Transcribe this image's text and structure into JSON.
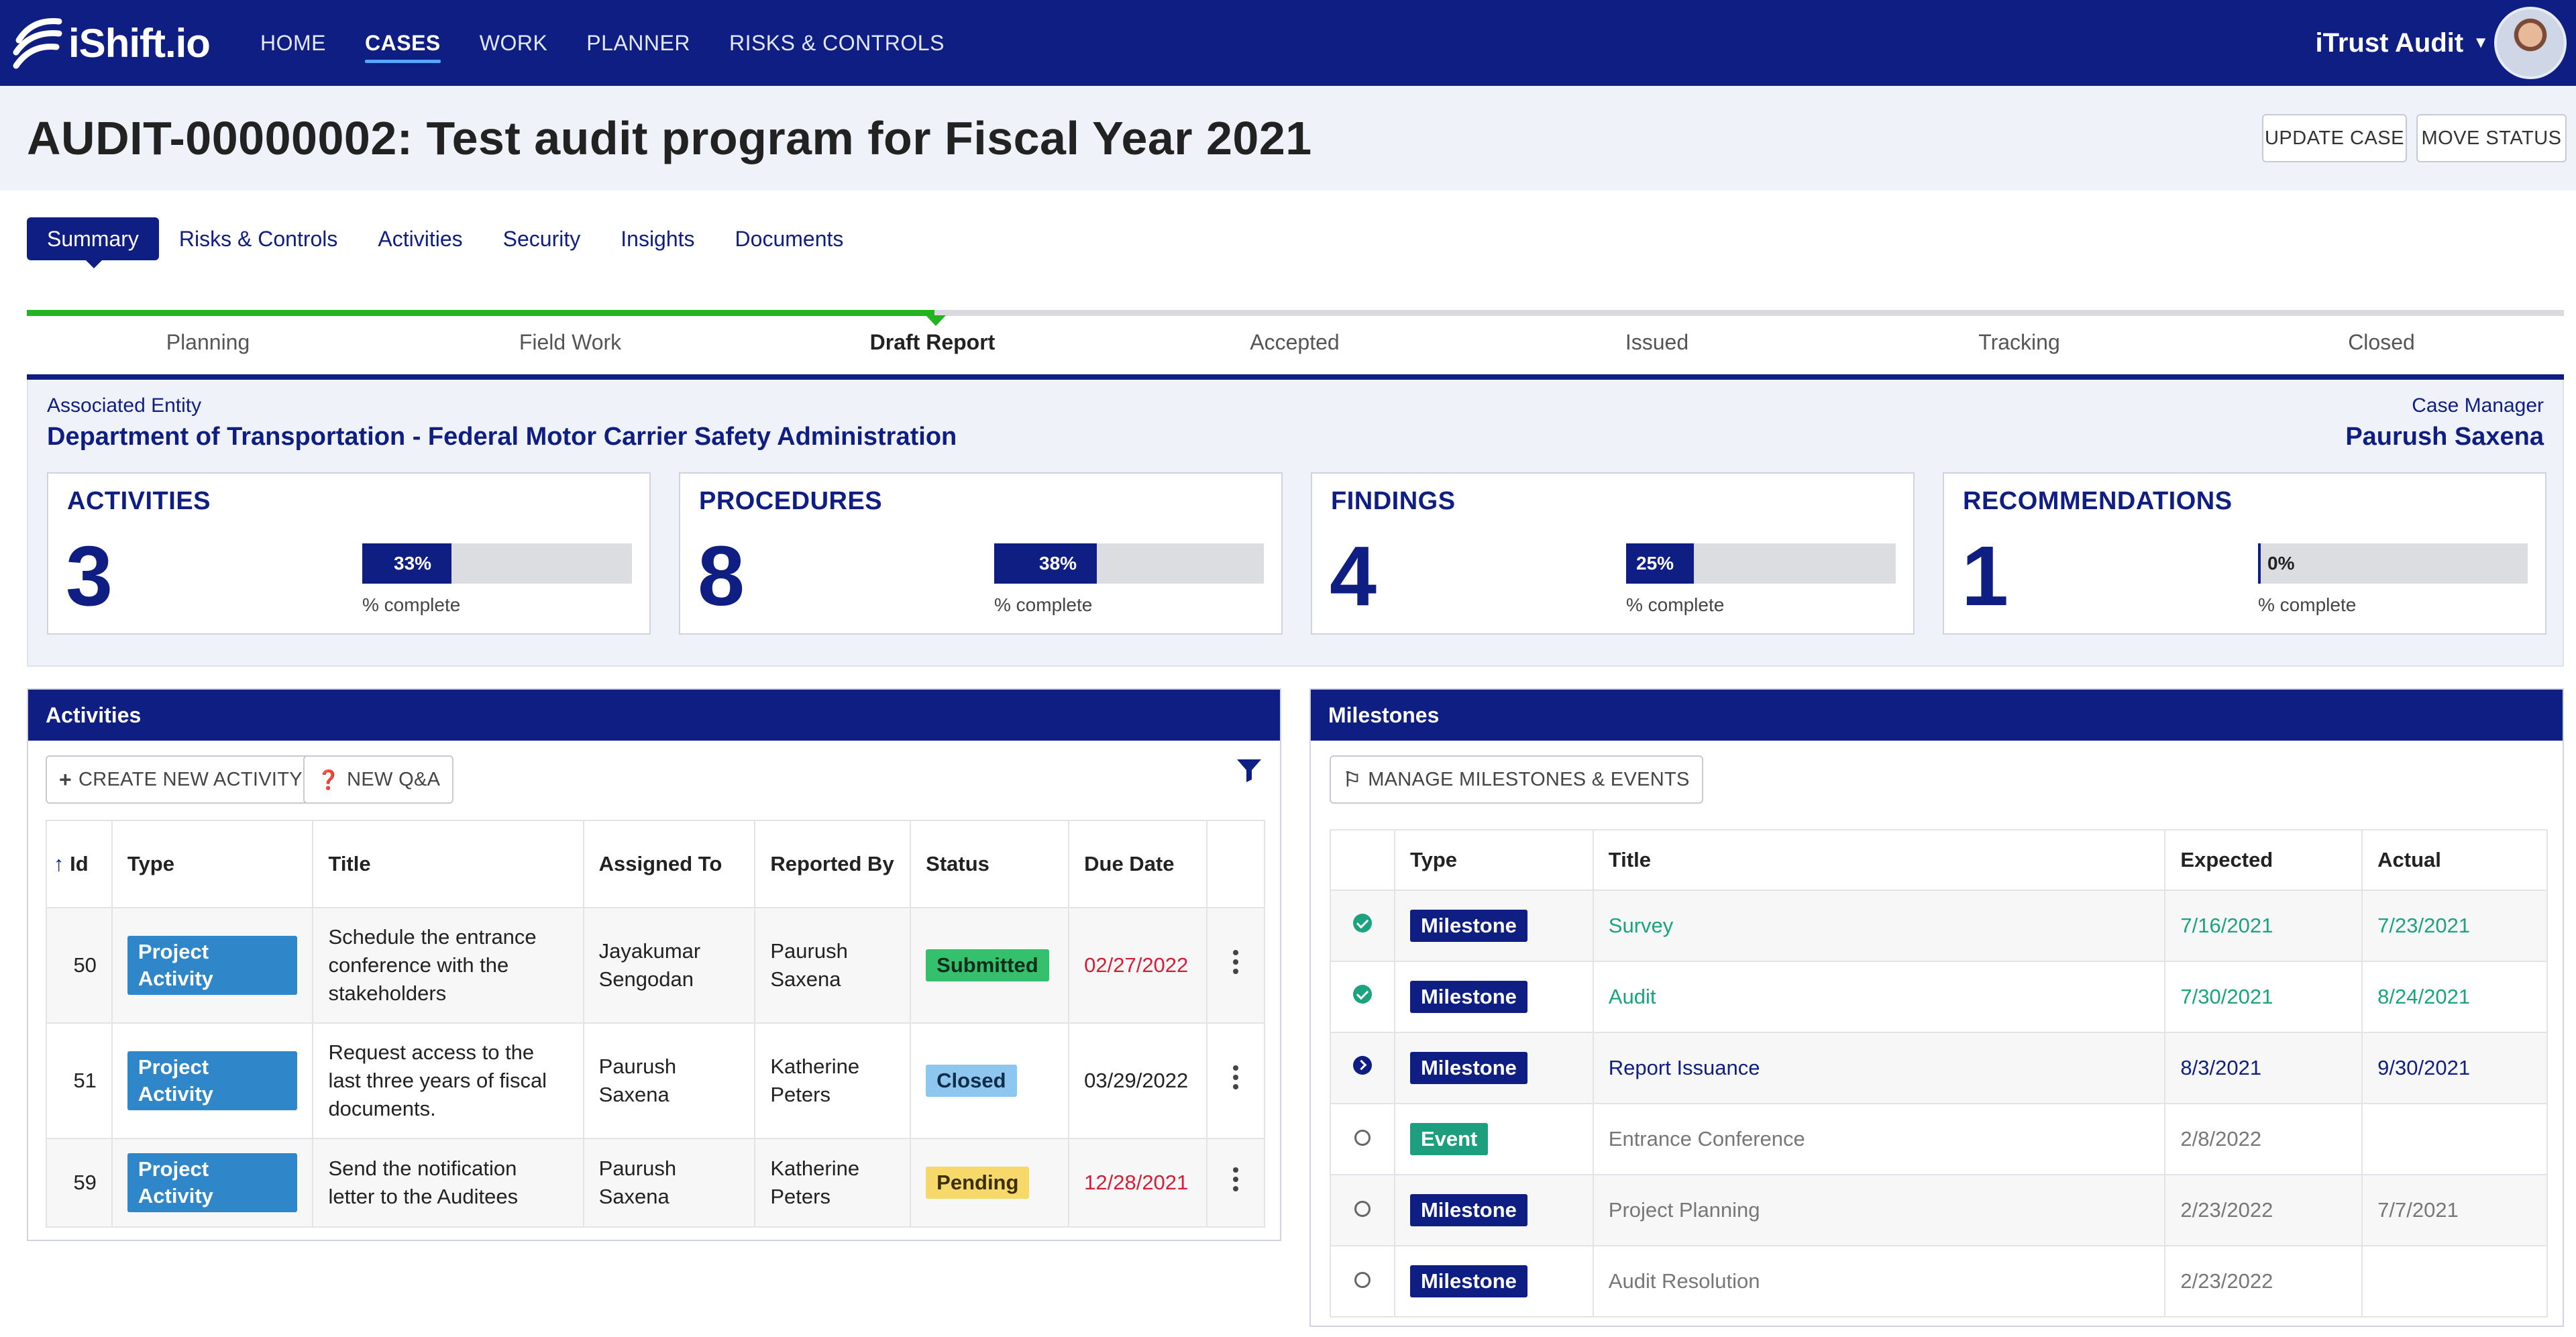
{
  "app": {
    "logo_text": "iShift.io",
    "nav": [
      "HOME",
      "CASES",
      "WORK",
      "PLANNER",
      "RISKS & CONTROLS"
    ],
    "active_nav": "CASES",
    "org_name": "iTrust Audit",
    "avatar": "user-avatar"
  },
  "case": {
    "title": "AUDIT-00000002: Test audit program for Fiscal Year 2021",
    "buttons": {
      "update": "UPDATE CASE",
      "move": "MOVE STATUS"
    },
    "tabs": [
      "Summary",
      "Risks & Controls",
      "Activities",
      "Security",
      "Insights",
      "Documents"
    ],
    "active_tab": "Summary",
    "stages": [
      "Planning",
      "Field Work",
      "Draft Report",
      "Accepted",
      "Issued",
      "Tracking",
      "Closed"
    ],
    "current_stage": "Draft Report",
    "entity_label": "Associated Entity",
    "entity_value": "Department of Transportation - Federal Motor Carrier Safety Administration",
    "manager_label": "Case Manager",
    "manager_value": "Paurush Saxena"
  },
  "stats": [
    {
      "title": "ACTIVITIES",
      "value": "3",
      "percent": 33,
      "percent_label": "33%",
      "caption": "% complete"
    },
    {
      "title": "PROCEDURES",
      "value": "8",
      "percent": 38,
      "percent_label": "38%",
      "caption": "% complete"
    },
    {
      "title": "FINDINGS",
      "value": "4",
      "percent": 25,
      "percent_label": "25%",
      "caption": "% complete"
    },
    {
      "title": "RECOMMENDATIONS",
      "value": "1",
      "percent": 0,
      "percent_label": "0%",
      "caption": "% complete"
    }
  ],
  "activities": {
    "heading": "Activities",
    "create_button": "CREATE NEW ACTIVITY",
    "qa_button": "NEW Q&A",
    "columns": [
      "Id",
      "Type",
      "Title",
      "Assigned To",
      "Reported By",
      "Status",
      "Due Date",
      ""
    ],
    "sort_icon": "arrow-up-icon",
    "rows": [
      {
        "id": "50",
        "type": "Project Activity",
        "title": "Schedule the entrance conference with the stakeholders",
        "assigned": "Jayakumar Sengodan",
        "reported": "Paurush Saxena",
        "status": "Submitted",
        "due": "02/27/2022",
        "overdue": true
      },
      {
        "id": "51",
        "type": "Project Activity",
        "title": "Request access to the last three years of fiscal documents.",
        "assigned": "Paurush Saxena",
        "reported": "Katherine Peters",
        "status": "Closed",
        "due": "03/29/2022",
        "overdue": false
      },
      {
        "id": "59",
        "type": "Project Activity",
        "title": "Send the notification letter to the Auditees",
        "assigned": "Paurush Saxena",
        "reported": "Katherine Peters",
        "status": "Pending",
        "due": "12/28/2021",
        "overdue": true
      }
    ]
  },
  "milestones": {
    "heading": "Milestones",
    "manage_button": "MANAGE MILESTONES & EVENTS",
    "columns": [
      "",
      "Type",
      "Title",
      "Expected",
      "Actual"
    ],
    "rows": [
      {
        "state": "done",
        "type": "Milestone",
        "title": "Survey",
        "expected": "7/16/2021",
        "actual": "7/23/2021"
      },
      {
        "state": "done",
        "type": "Milestone",
        "title": "Audit",
        "expected": "7/30/2021",
        "actual": "8/24/2021"
      },
      {
        "state": "current",
        "type": "Milestone",
        "title": "Report Issuance",
        "expected": "8/3/2021",
        "actual": "9/30/2021"
      },
      {
        "state": "open",
        "type": "Event",
        "title": "Entrance Conference",
        "expected": "2/8/2022",
        "actual": ""
      },
      {
        "state": "open",
        "type": "Milestone",
        "title": "Project Planning",
        "expected": "2/23/2022",
        "actual": "7/7/2021"
      },
      {
        "state": "open",
        "type": "Milestone",
        "title": "Audit Resolution",
        "expected": "2/23/2022",
        "actual": ""
      }
    ]
  },
  "colors": {
    "brand": "#0f1e82",
    "progress": "#22b321",
    "project_badge": "#2f86c9",
    "submitted": "#35c06d",
    "closed": "#8dc6ee",
    "pending": "#f6d86b",
    "event": "#1d9e7e",
    "overdue": "#d21f36"
  }
}
